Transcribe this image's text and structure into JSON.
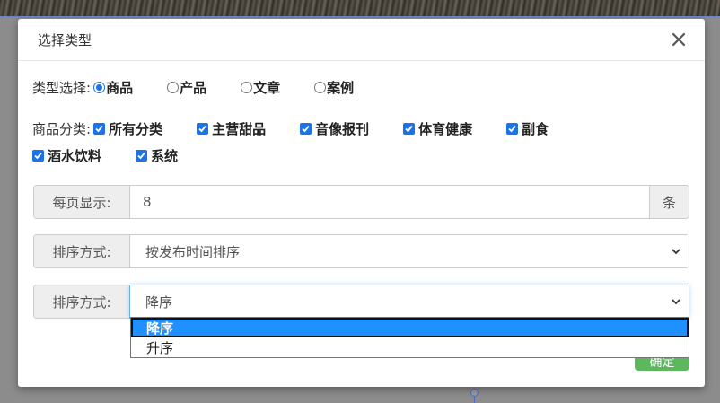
{
  "modal": {
    "title": "选择类型",
    "close_icon": "close-icon"
  },
  "type_select": {
    "label": "类型选择:",
    "options": [
      {
        "label": "商品",
        "checked": true
      },
      {
        "label": "产品",
        "checked": false
      },
      {
        "label": "文章",
        "checked": false
      },
      {
        "label": "案例",
        "checked": false
      }
    ]
  },
  "category": {
    "label": "商品分类:",
    "items": [
      {
        "label": "所有分类",
        "checked": true
      },
      {
        "label": "主营甜品",
        "checked": true
      },
      {
        "label": "音像报刊",
        "checked": true
      },
      {
        "label": "体育健康",
        "checked": true
      },
      {
        "label": "副食",
        "checked": true
      },
      {
        "label": "酒水饮料",
        "checked": true
      },
      {
        "label": "系统",
        "checked": true
      }
    ]
  },
  "per_page": {
    "label": "每页显示:",
    "value": "8",
    "suffix": "条"
  },
  "sort_field": {
    "label": "排序方式:",
    "value": "按发布时间排序"
  },
  "sort_order": {
    "label": "排序方式:",
    "value": "降序",
    "options": [
      "降序",
      "升序"
    ]
  },
  "confirm": {
    "label": "确定"
  },
  "colors": {
    "accent": "#1a73e8",
    "dropdown_highlight": "#1e90ff",
    "confirm_green": "#5cb85c"
  }
}
